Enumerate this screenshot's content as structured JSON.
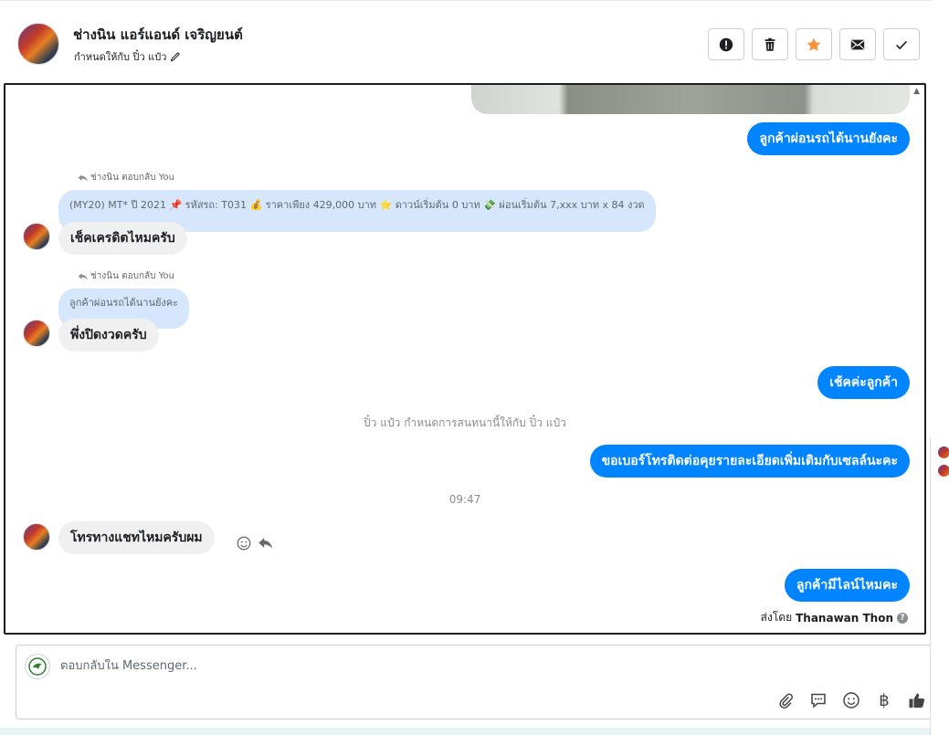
{
  "header": {
    "contact_name": "ช่างนิน แอร์แอนด์ เจริญยนต์",
    "assign_text": "กำหนดให้กับ ปิ๋ว แป๋ว",
    "icons": [
      "alert-circle-icon",
      "trash-icon",
      "star-icon",
      "envelope-icon",
      "check-icon"
    ],
    "star_color": "#f7923a"
  },
  "messages": {
    "m1": {
      "text": "ลูกค้าผ่อนรถได้นานยังคะ"
    },
    "m2": {
      "reply_meta": "ช่างนิน ตอบกลับ You",
      "quote": "(MY20) MT* ปี 2021 📌 รหัสรถ: T031 💰 ราคาเพียง 429,000 บาท ⭐ ดาวน์เริ่มต้น 0 บาท 💸 ผ่อนเริ่มต้น 7,xxx บาท x 84 งวด",
      "text": "เช็คเครดิตไหมครับ"
    },
    "m3": {
      "reply_meta": "ช่างนิน ตอบกลับ You",
      "quote": "ลูกค้าผ่อนรถได้นานยังคะ",
      "text": "พึ่งปิดงวดครับ"
    },
    "m4": {
      "text": "เช้คค่ะลูกค้า"
    },
    "system_note": "ปิ๋ว แป๋ว กำหนดการสนทนานี้ให้กับ ปิ๋ว แป๋ว",
    "m5": {
      "text": "ขอเบอร์โทรติดต่อคุยรายละเอียดเพิ่มเติมกับเซลล์นะคะ"
    },
    "time": "09:47",
    "m6": {
      "text": "โทรทางแชทไหมครับผม"
    },
    "m7": {
      "text": "ลูกค้ามีไลน์ไหมคะ"
    },
    "sent_by_label": "ส่งโดย",
    "sent_by_name": "Thanawan Thon"
  },
  "composer": {
    "placeholder": "ตอบกลับใน Messenger...",
    "baht_symbol": "฿",
    "accent": "#0084ff"
  }
}
